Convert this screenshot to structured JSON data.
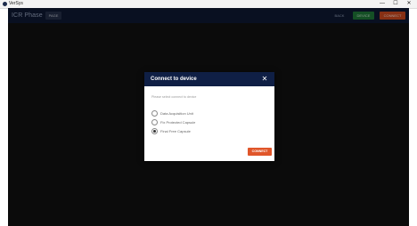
{
  "os": {
    "title": "VerSys",
    "controls": {
      "minimize": "—",
      "maximize": "☐",
      "close": "✕"
    }
  },
  "header": {
    "brand": "ICR Phase",
    "phase_button": "PAGE",
    "back_button": "BACK",
    "green_button": "DEVICE",
    "orange_button": "CONNECT"
  },
  "modal": {
    "title": "Connect to device",
    "close_glyph": "✕",
    "description": "Please select connect to device",
    "options": [
      {
        "label": "Data Acquisition Unit",
        "checked": false
      },
      {
        "label": "Fix Protected Capsule",
        "checked": false
      },
      {
        "label": "Final Free Capsule",
        "checked": true
      }
    ],
    "connect_label": "CONNECT"
  }
}
